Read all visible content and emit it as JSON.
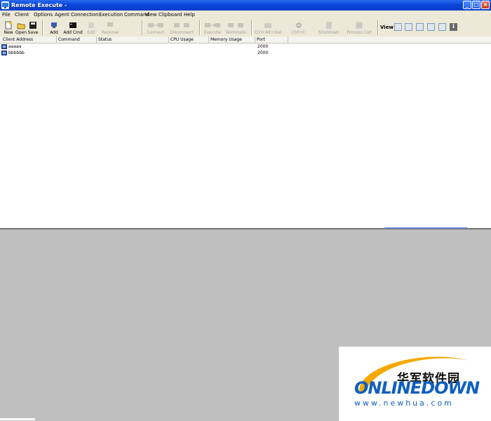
{
  "window": {
    "title": "Remote Execute -",
    "minimize": "_",
    "maximize": "□",
    "close": "×"
  },
  "menu": [
    "File",
    "Client",
    "Options",
    "Agent",
    "Connection",
    "Execution",
    "Command",
    "View",
    "Clipboard",
    "Help"
  ],
  "toolbar": {
    "new": "New",
    "open": "Open",
    "save": "Save",
    "add": "Add",
    "add_cmd": "Add Cmd",
    "edit": "Edit",
    "remove": "Remove",
    "connect": "Connect",
    "disconnect": "Disconnect",
    "execute": "Execute",
    "terminate": "Terminate",
    "ctrl_alt_del": "Ctrl+Alt+Del",
    "ctrl_c": "Ctrl+C",
    "shutdown": "Shutdown",
    "process_list": "Process List",
    "view_label": "View"
  },
  "table": {
    "columns": [
      "Client Address",
      "Command",
      "Status",
      "CPU Usage",
      "Memory Usage",
      "Port"
    ],
    "rows": [
      {
        "address": "aaaaa",
        "command": "",
        "status": "",
        "cpu": "",
        "memory": "",
        "port": "2000"
      },
      {
        "address": "bbbbbb",
        "command": "",
        "status": "",
        "cpu": "",
        "memory": "",
        "port": "2000"
      }
    ]
  },
  "watermark": {
    "chinese": "华军软件园",
    "brand": "ONLINEDOWN",
    "url": "www.newhua.com"
  },
  "colors": {
    "titlebar": "#0a46d8",
    "chrome": "#ece9d8",
    "list_bg": "#ffffff",
    "lower_pane": "#bfbfbf",
    "watermark_blue": "#0f5fc0",
    "watermark_orange": "#f5a800"
  }
}
